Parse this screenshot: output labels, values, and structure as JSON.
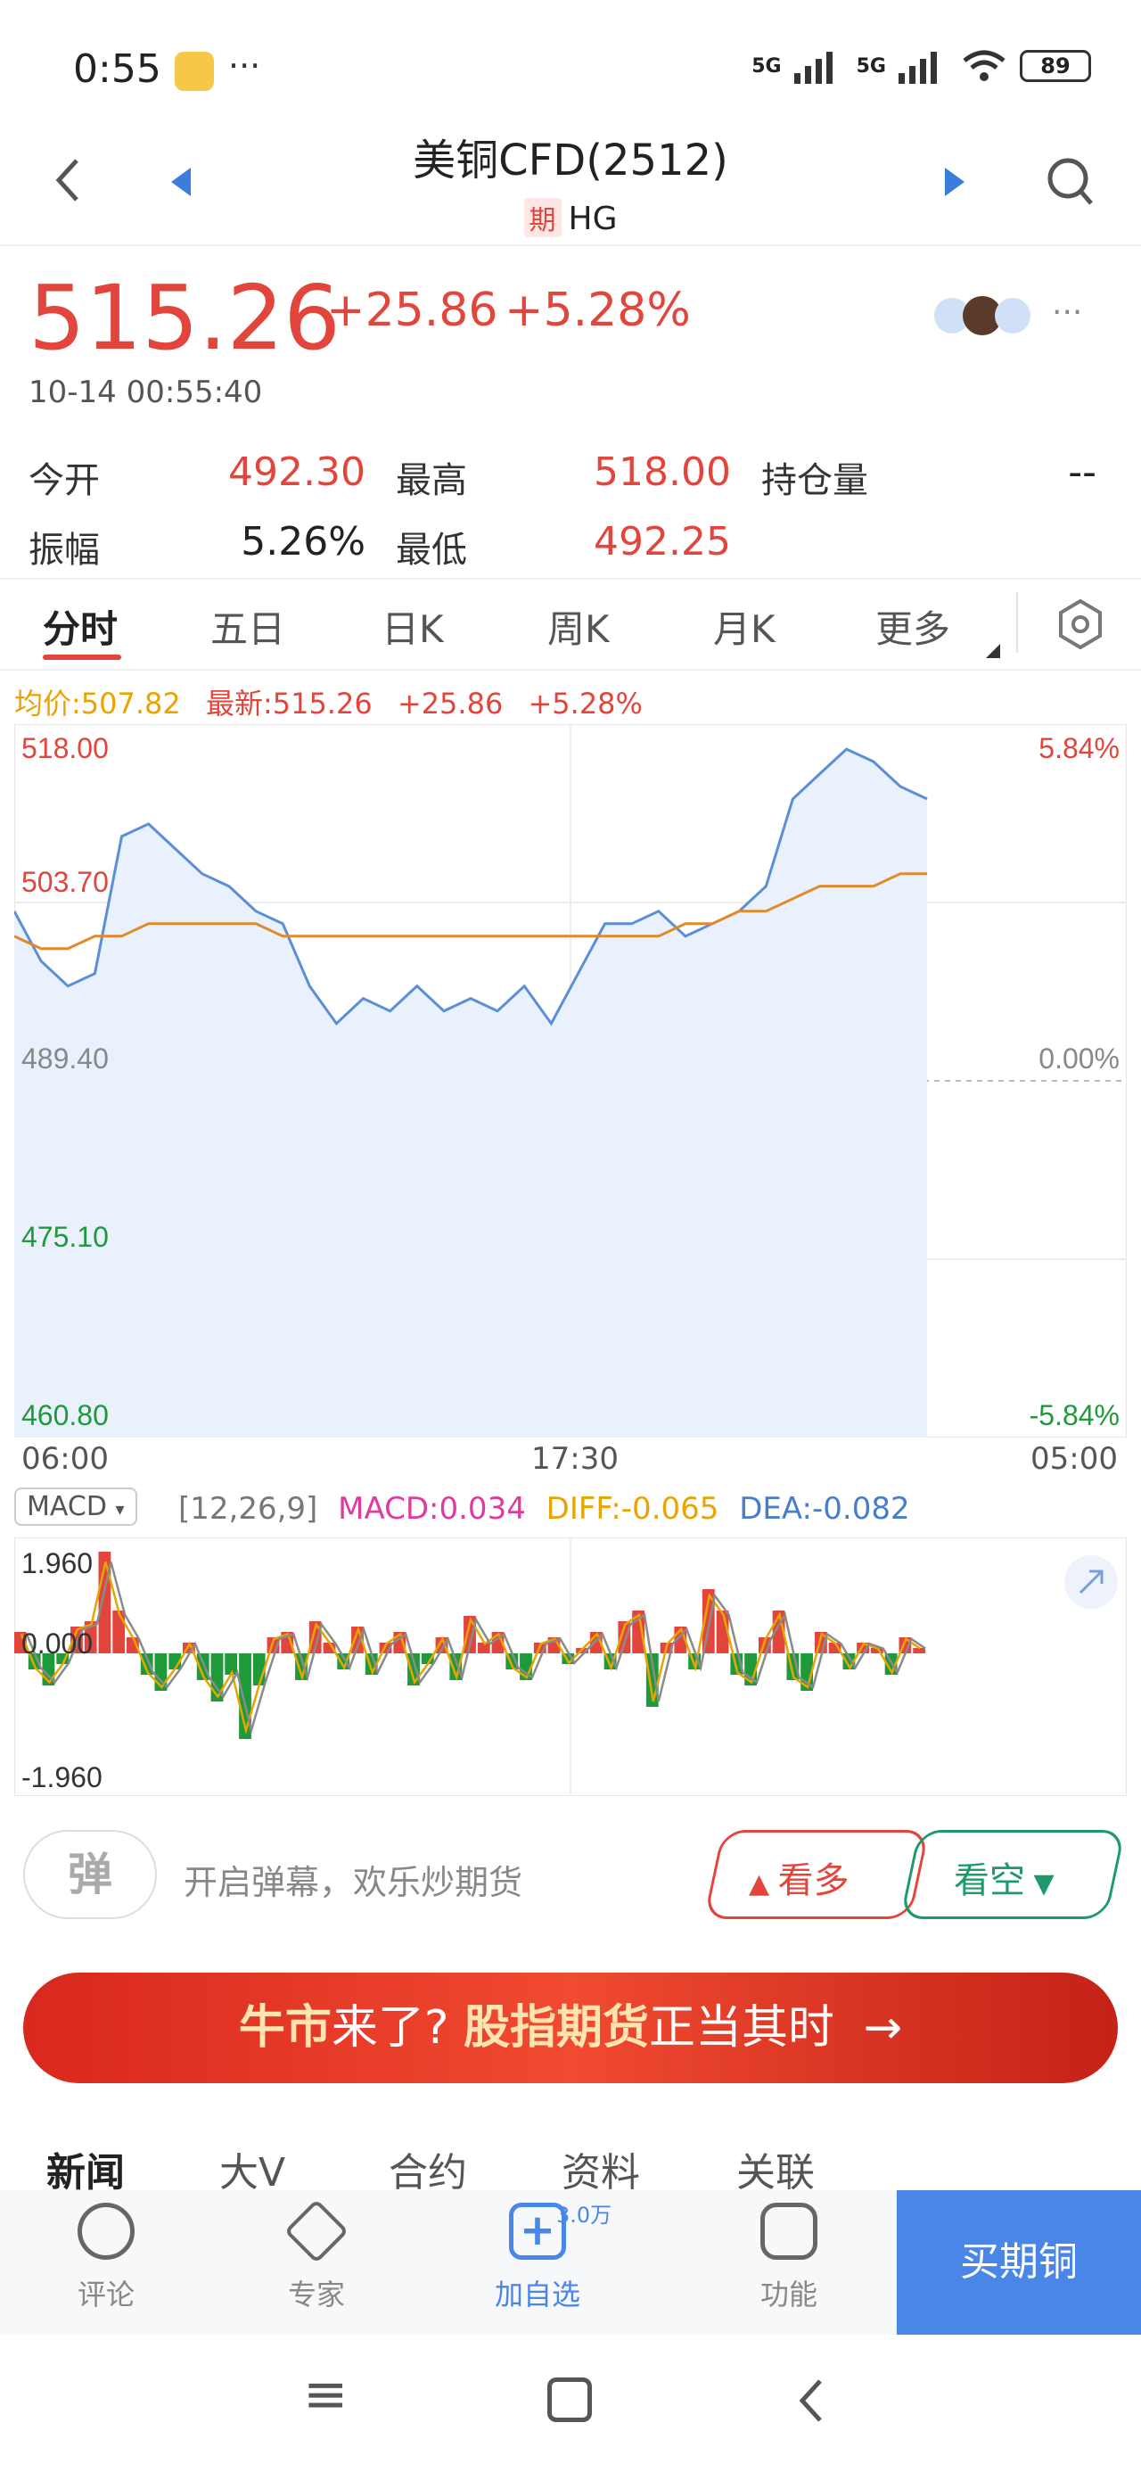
{
  "status_bar": {
    "time": "0:55",
    "dots": "···",
    "signal1": "5G",
    "signal2": "5G",
    "battery": "89"
  },
  "header": {
    "title": "美铜CFD(2512)",
    "tag": "期",
    "symbol": "HG"
  },
  "quote": {
    "price": "515.26",
    "change": "+25.86",
    "change_pct": "+5.28%",
    "timestamp": "10-14 00:55:40",
    "open_label": "今开",
    "open": "492.30",
    "high_label": "最高",
    "high": "518.00",
    "oi_label": "持仓量",
    "oi": "--",
    "amp_label": "振幅",
    "amp": "5.26%",
    "low_label": "最低",
    "low": "492.25",
    "more": "···"
  },
  "chart_tabs": [
    "分时",
    "五日",
    "日K",
    "周K",
    "月K",
    "更多"
  ],
  "chart_info": {
    "avg": "均价:507.82",
    "latest": "最新:515.26",
    "chg": "+25.86",
    "pct": "+5.28%"
  },
  "chart_data": {
    "type": "line",
    "y_ticks": [
      "518.00",
      "503.70",
      "489.40",
      "475.10",
      "460.80"
    ],
    "pct_ticks": [
      "5.84%",
      "0.00%",
      "-5.84%"
    ],
    "x_ticks": [
      "06:00",
      "17:30",
      "05:00"
    ],
    "ylim": [
      460.8,
      518.0
    ],
    "base": 489.4,
    "series": [
      {
        "values": [
          503,
          499,
          497,
          498,
          509,
          510,
          508,
          506,
          505,
          503,
          502,
          497,
          494,
          496,
          495,
          497,
          495,
          496,
          495,
          497,
          494,
          498,
          502,
          502,
          503,
          501,
          502,
          503,
          505,
          512,
          514,
          516,
          515,
          513,
          512
        ]
      },
      {
        "values": [
          501,
          500,
          500,
          501,
          501,
          502,
          502,
          502,
          502,
          502,
          501,
          501,
          501,
          501,
          501,
          501,
          501,
          501,
          501,
          501,
          501,
          501,
          501,
          501,
          501,
          502,
          502,
          503,
          503,
          504,
          505,
          505,
          505,
          506,
          506
        ]
      }
    ]
  },
  "macd": {
    "label": "MACD",
    "params": "[12,26,9]",
    "macd": "MACD:0.034",
    "diff": "DIFF:-0.065",
    "dea": "DEA:-0.082",
    "y_ticks": [
      "1.960",
      "0.000",
      "-1.960"
    ],
    "values": [
      0.4,
      -0.3,
      -0.6,
      -0.2,
      0.5,
      0.6,
      1.9,
      0.8,
      0.3,
      -0.4,
      -0.7,
      -0.3,
      0.2,
      -0.5,
      -0.9,
      -0.4,
      -1.6,
      -0.6,
      0.3,
      0.4,
      -0.5,
      0.6,
      0.2,
      -0.3,
      0.5,
      -0.4,
      0.2,
      0.4,
      -0.6,
      -0.2,
      0.3,
      -0.5,
      0.7,
      0.2,
      0.4,
      -0.3,
      -0.5,
      0.2,
      0.3,
      -0.2,
      0.1,
      0.4,
      -0.3,
      0.6,
      0.8,
      -1.0,
      0.2,
      0.5,
      -0.3,
      1.2,
      0.8,
      -0.4,
      -0.6,
      0.3,
      0.8,
      -0.5,
      -0.7,
      0.4,
      0.2,
      -0.3,
      0.2,
      0.1,
      -0.4,
      0.3,
      0.1
    ]
  },
  "danmu": {
    "icon": "弹",
    "text": "开启弹幕，欢乐炒期货"
  },
  "actions": {
    "bull": "看多",
    "bear": "看空"
  },
  "banner": {
    "p1": "牛市",
    "p2": "来了? ",
    "p3": "股指期货",
    "p4": "正当其时",
    "arrow": "→"
  },
  "news_tabs": [
    "新闻",
    "大V",
    "合约",
    "资料",
    "关联"
  ],
  "bottom_bar": {
    "comment": "评论",
    "expert": "专家",
    "add": "加自选",
    "add_badge": "3.0万",
    "func": "功能",
    "buy": "买期铜"
  }
}
